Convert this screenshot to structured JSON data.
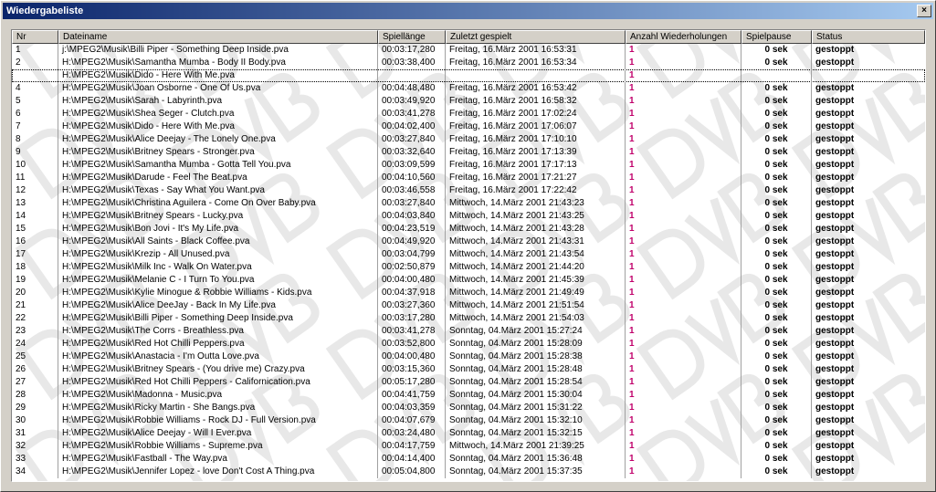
{
  "window": {
    "title": "Wiedergabeliste",
    "close_label": "×"
  },
  "table": {
    "columns": [
      "Nr",
      "Dateiname",
      "Spiellänge",
      "Zuletzt gespielt",
      "Anzahl Wiederholungen",
      "Spielpause",
      "Status"
    ],
    "selected_row": 3,
    "rows": [
      [
        "1",
        "j:\\MPEG2\\Musik\\Billi Piper - Something Deep Inside.pva",
        "00:03:17,280",
        "Freitag, 16.März 2001 16:53:31",
        "1",
        "0 sek",
        "gestoppt"
      ],
      [
        "2",
        "H:\\MPEG2\\Musik\\Samantha Mumba - Body II Body.pva",
        "00:03:38,400",
        "Freitag, 16.März 2001 16:53:34",
        "1",
        "0 sek",
        "gestoppt"
      ],
      [
        "",
        "H:\\MPEG2\\Musik\\Dido - Here With Me.pva",
        "",
        "",
        "1",
        "",
        ""
      ],
      [
        "4",
        "H:\\MPEG2\\Musik\\Joan Osborne - One Of Us.pva",
        "00:04:48,480",
        "Freitag, 16.März 2001 16:53:42",
        "1",
        "0 sek",
        "gestoppt"
      ],
      [
        "5",
        "H:\\MPEG2\\Musik\\Sarah - Labyrinth.pva",
        "00:03:49,920",
        "Freitag, 16.März 2001 16:58:32",
        "1",
        "0 sek",
        "gestoppt"
      ],
      [
        "6",
        "H:\\MPEG2\\Musik\\Shea Seger - Clutch.pva",
        "00:03:41,278",
        "Freitag, 16.März 2001 17:02:24",
        "1",
        "0 sek",
        "gestoppt"
      ],
      [
        "7",
        "H:\\MPEG2\\Musik\\Dido - Here With Me.pva",
        "00:04:02,400",
        "Freitag, 16.März 2001 17:06:07",
        "1",
        "0 sek",
        "gestoppt"
      ],
      [
        "8",
        "H:\\MPEG2\\Musik\\Alice Deejay - The Lonely One.pva",
        "00:03:27,840",
        "Freitag, 16.März 2001 17:10:10",
        "1",
        "0 sek",
        "gestoppt"
      ],
      [
        "9",
        "H:\\MPEG2\\Musik\\Britney Spears - Stronger.pva",
        "00:03:32,640",
        "Freitag, 16.März 2001 17:13:39",
        "1",
        "0 sek",
        "gestoppt"
      ],
      [
        "10",
        "H:\\MPEG2\\Musik\\Samantha Mumba - Gotta Tell You.pva",
        "00:03:09,599",
        "Freitag, 16.März 2001 17:17:13",
        "1",
        "0 sek",
        "gestoppt"
      ],
      [
        "11",
        "H:\\MPEG2\\Musik\\Darude - Feel The Beat.pva",
        "00:04:10,560",
        "Freitag, 16.März 2001 17:21:27",
        "1",
        "0 sek",
        "gestoppt"
      ],
      [
        "12",
        "H:\\MPEG2\\Musik\\Texas - Say What You Want.pva",
        "00:03:46,558",
        "Freitag, 16.März 2001 17:22:42",
        "1",
        "0 sek",
        "gestoppt"
      ],
      [
        "13",
        "H:\\MPEG2\\Musik\\Christina Aguilera - Come On Over Baby.pva",
        "00:03:27,840",
        "Mittwoch, 14.März 2001 21:43:23",
        "1",
        "0 sek",
        "gestoppt"
      ],
      [
        "14",
        "H:\\MPEG2\\Musik\\Britney Spears - Lucky.pva",
        "00:04:03,840",
        "Mittwoch, 14.März 2001 21:43:25",
        "1",
        "0 sek",
        "gestoppt"
      ],
      [
        "15",
        "H:\\MPEG2\\Musik\\Bon Jovi - It's My Life.pva",
        "00:04:23,519",
        "Mittwoch, 14.März 2001 21:43:28",
        "1",
        "0 sek",
        "gestoppt"
      ],
      [
        "16",
        "H:\\MPEG2\\Musik\\All Saints - Black Coffee.pva",
        "00:04:49,920",
        "Mittwoch, 14.März 2001 21:43:31",
        "1",
        "0 sek",
        "gestoppt"
      ],
      [
        "17",
        "H:\\MPEG2\\Musik\\Krezip - All Unused.pva",
        "00:03:04,799",
        "Mittwoch, 14.März 2001 21:43:54",
        "1",
        "0 sek",
        "gestoppt"
      ],
      [
        "18",
        "H:\\MPEG2\\Musik\\Milk Inc - Walk On Water.pva",
        "00:02:50,879",
        "Mittwoch, 14.März 2001 21:44:20",
        "1",
        "0 sek",
        "gestoppt"
      ],
      [
        "19",
        "H:\\MPEG2\\Musik\\Melanie C - I Turn To You.pva",
        "00:04:00,480",
        "Mittwoch, 14.März 2001 21:45:39",
        "1",
        "0 sek",
        "gestoppt"
      ],
      [
        "20",
        "H:\\MPEG2\\Musik\\Kylie Minogue & Robbie Williams - Kids.pva",
        "00:04:37,918",
        "Mittwoch, 14.März 2001 21:49:49",
        "1",
        "0 sek",
        "gestoppt"
      ],
      [
        "21",
        "H:\\MPEG2\\Musik\\Alice DeeJay - Back In My Life.pva",
        "00:03:27,360",
        "Mittwoch, 14.März 2001 21:51:54",
        "1",
        "0 sek",
        "gestoppt"
      ],
      [
        "22",
        "H:\\MPEG2\\Musik\\Billi Piper - Something Deep Inside.pva",
        "00:03:17,280",
        "Mittwoch, 14.März 2001 21:54:03",
        "1",
        "0 sek",
        "gestoppt"
      ],
      [
        "23",
        "H:\\MPEG2\\Musik\\The Corrs - Breathless.pva",
        "00:03:41,278",
        "Sonntag, 04.März 2001 15:27:24",
        "1",
        "0 sek",
        "gestoppt"
      ],
      [
        "24",
        "H:\\MPEG2\\Musik\\Red Hot Chilli Peppers.pva",
        "00:03:52,800",
        "Sonntag, 04.März 2001 15:28:09",
        "1",
        "0 sek",
        "gestoppt"
      ],
      [
        "25",
        "H:\\MPEG2\\Musik\\Anastacia - I'm Outta Love.pva",
        "00:04:00,480",
        "Sonntag, 04.März 2001 15:28:38",
        "1",
        "0 sek",
        "gestoppt"
      ],
      [
        "26",
        "H:\\MPEG2\\Musik\\Britney Spears - (You drive me) Crazy.pva",
        "00:03:15,360",
        "Sonntag, 04.März 2001 15:28:48",
        "1",
        "0 sek",
        "gestoppt"
      ],
      [
        "27",
        "H:\\MPEG2\\Musik\\Red Hot Chilli Peppers - Californication.pva",
        "00:05:17,280",
        "Sonntag, 04.März 2001 15:28:54",
        "1",
        "0 sek",
        "gestoppt"
      ],
      [
        "28",
        "H:\\MPEG2\\Musik\\Madonna - Music.pva",
        "00:04:41,759",
        "Sonntag, 04.März 2001 15:30:04",
        "1",
        "0 sek",
        "gestoppt"
      ],
      [
        "29",
        "H:\\MPEG2\\Musik\\Ricky Martin - She Bangs.pva",
        "00:04:03,359",
        "Sonntag, 04.März 2001 15:31:22",
        "1",
        "0 sek",
        "gestoppt"
      ],
      [
        "30",
        "H:\\MPEG2\\Musik\\Robbie Williams - Rock DJ - Full Version.pva",
        "00:04:07,679",
        "Sonntag, 04.März 2001 15:32:10",
        "1",
        "0 sek",
        "gestoppt"
      ],
      [
        "31",
        "H:\\MPEG2\\Musik\\Alice Deejay - Will I Ever.pva",
        "00:03:24,480",
        "Sonntag, 04.März 2001 15:32:15",
        "1",
        "0 sek",
        "gestoppt"
      ],
      [
        "32",
        "H:\\MPEG2\\Musik\\Robbie Williams - Supreme.pva",
        "00:04:17,759",
        "Mittwoch, 14.März 2001 21:39:25",
        "1",
        "0 sek",
        "gestoppt"
      ],
      [
        "33",
        "H:\\MPEG2\\Musik\\Fastball - The Way.pva",
        "00:04:14,400",
        "Sonntag, 04.März 2001 15:36:48",
        "1",
        "0 sek",
        "gestoppt"
      ],
      [
        "34",
        "H:\\MPEG2\\Musik\\Jennifer Lopez - love Don't Cost A Thing.pva",
        "00:05:04,800",
        "Sonntag, 04.März 2001 15:37:35",
        "1",
        "0 sek",
        "gestoppt"
      ]
    ]
  },
  "colors": {
    "titlebar_start": "#0a246a",
    "titlebar_end": "#a6caf0",
    "repeat_count": "#c0006a",
    "watermark": "#e8e8e8"
  }
}
